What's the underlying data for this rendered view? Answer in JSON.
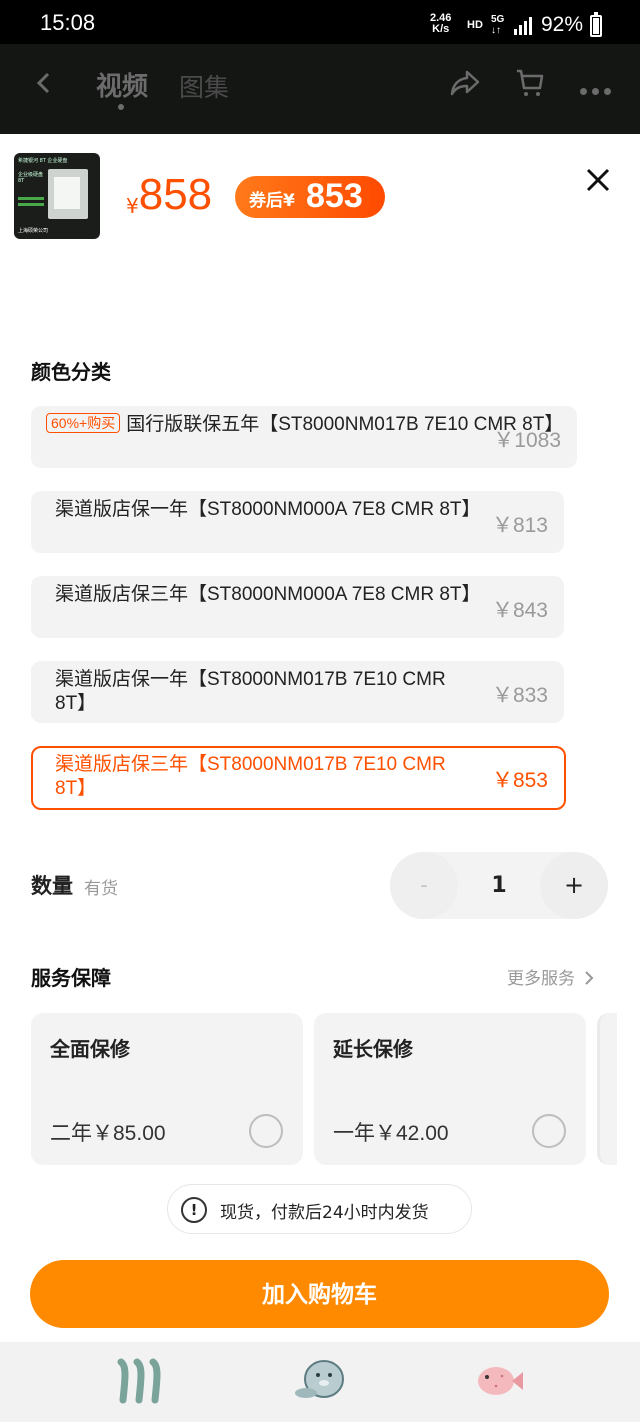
{
  "status_bar": {
    "time": "15:08",
    "net_speed": "2.46",
    "net_unit": "K/s",
    "hd": "HD",
    "network": "5G",
    "battery": "92%"
  },
  "top_nav": {
    "tabs": [
      "视频",
      "图集"
    ],
    "icons": [
      "back-icon",
      "share-icon",
      "cart-icon",
      "more-icon"
    ]
  },
  "product": {
    "thumb_text": [
      "希捷银河 8T 企业硬盘",
      "企业级硬盘8T",
      "上海硕荣公司"
    ],
    "currency": "¥",
    "price": "858",
    "coupon_label": "券后¥",
    "coupon_price": "853"
  },
  "color_section": {
    "title": "颜色分类",
    "options": [
      {
        "badge": "60%+购买",
        "name": "国行版联保五年【ST8000NM017B 7E10 CMR 8T】",
        "price": "￥1083",
        "selected": false
      },
      {
        "badge": "",
        "name": "渠道版店保一年【ST8000NM000A 7E8 CMR 8T】",
        "price": "￥813",
        "selected": false
      },
      {
        "badge": "",
        "name": "渠道版店保三年【ST8000NM000A 7E8 CMR 8T】",
        "price": "￥843",
        "selected": false
      },
      {
        "badge": "",
        "name": "渠道版店保一年【ST8000NM017B 7E10 CMR 8T】",
        "price": "￥833",
        "selected": false
      },
      {
        "badge": "",
        "name": "渠道版店保三年【ST8000NM017B 7E10 CMR 8T】",
        "price": "￥853",
        "selected": true
      }
    ]
  },
  "quantity": {
    "label": "数量",
    "stock": "有货",
    "minus": "-",
    "value": "1",
    "plus": "+"
  },
  "service": {
    "title": "服务保障",
    "more": "更多服务",
    "cards": [
      {
        "title": "全面保修",
        "desc": "二年￥85.00"
      },
      {
        "title": "延长保修",
        "desc": "一年￥42.00"
      }
    ]
  },
  "notice": {
    "icon": "!",
    "text": "现货，付款后24小时内发货"
  },
  "actions": {
    "add_to_cart": "加入购物车"
  },
  "colors": {
    "accent": "#ff5000",
    "button": "#ff8a00"
  }
}
